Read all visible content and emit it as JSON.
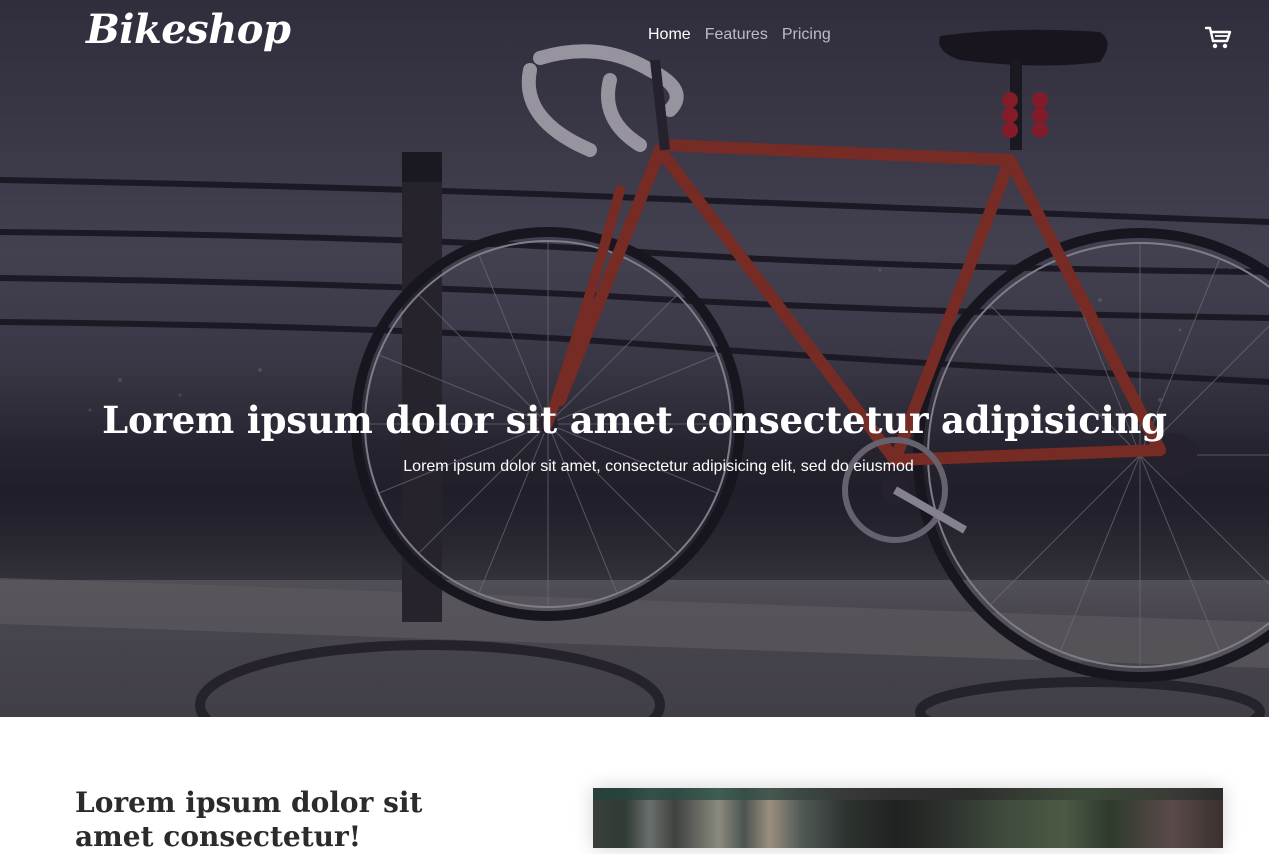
{
  "brand": {
    "name": "Bikeshop"
  },
  "nav": {
    "items": [
      {
        "label": "Home",
        "active": true
      },
      {
        "label": "Features",
        "active": false
      },
      {
        "label": "Pricing",
        "active": false
      }
    ],
    "cart_icon": "shopping-cart-icon"
  },
  "hero": {
    "title": "Lorem ipsum dolor sit amet consectetur adipisicing",
    "subtitle": "Lorem ipsum dolor sit amet, consectetur adipisicing elit, sed do eiusmod"
  },
  "section": {
    "heading": "Lorem ipsum dolor sit amet consectetur!"
  },
  "colors": {
    "nav_active": "#ffffff",
    "nav_inactive": "#bdbcc4",
    "bike_frame": "#b23a26",
    "heading_text": "#2b2b2b"
  }
}
